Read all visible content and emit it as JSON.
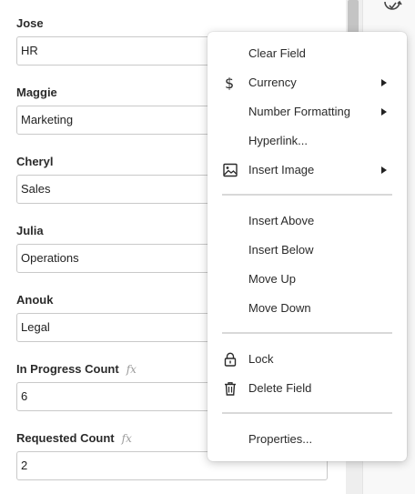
{
  "fields": [
    {
      "label": "Jose",
      "value": "HR",
      "formula": false
    },
    {
      "label": "Maggie",
      "value": "Marketing",
      "formula": false
    },
    {
      "label": "Cheryl",
      "value": "Sales",
      "formula": false
    },
    {
      "label": "Julia",
      "value": "Operations",
      "formula": false
    },
    {
      "label": "Anouk",
      "value": "Legal",
      "formula": false
    },
    {
      "label": "In Progress Count",
      "value": "6",
      "formula": true
    },
    {
      "label": "Requested Count",
      "value": "2",
      "formula": true
    }
  ],
  "formula_glyph": "fx",
  "context_menu": {
    "clear_field": "Clear Field",
    "currency": "Currency",
    "number_formatting": "Number Formatting",
    "hyperlink": "Hyperlink...",
    "insert_image": "Insert Image",
    "insert_above": "Insert Above",
    "insert_below": "Insert Below",
    "move_up": "Move Up",
    "move_down": "Move Down",
    "lock": "Lock",
    "delete_field": "Delete Field",
    "properties": "Properties..."
  },
  "icons": {
    "currency": "dollar-icon",
    "insert_image": "image-icon",
    "lock": "lock-icon",
    "delete_field": "trash-icon",
    "sync": "sync-icon"
  },
  "colors": {
    "menu_bg": "#ffffff",
    "separator": "#d8d8d8",
    "input_border": "#c9c9c9",
    "scroll_thumb": "#c4c4c4"
  }
}
